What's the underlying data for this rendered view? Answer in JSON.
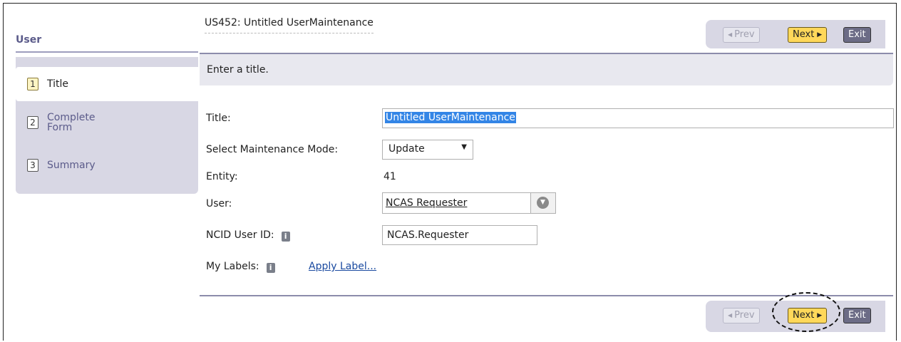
{
  "sidebar": {
    "title": "User",
    "items": [
      {
        "num": "1",
        "label": "Title"
      },
      {
        "num": "2",
        "label_line1": "Complete",
        "label_line2": "Form"
      },
      {
        "num": "3",
        "label": "Summary"
      }
    ]
  },
  "header": {
    "title": "US452: Untitled UserMaintenance"
  },
  "nav": {
    "prev": "Prev",
    "next": "Next",
    "exit": "Exit"
  },
  "instruction": "Enter a title.",
  "form": {
    "title_label": "Title:",
    "title_value": "Untitled UserMaintenance",
    "mode_label": "Select Maintenance Mode:",
    "mode_value": "Update",
    "entity_label": "Entity:",
    "entity_value": "41",
    "user_label": "User:",
    "user_value": "NCAS Requester",
    "ncid_label": "NCID User ID:",
    "ncid_value": "NCAS.Requester",
    "labels_label": "My Labels:",
    "apply_label": "Apply Label..."
  },
  "icons": {
    "info": "info-icon",
    "dropdown": "chevron-down-icon",
    "prev": "triangle-left-icon",
    "next": "triangle-right-icon"
  }
}
